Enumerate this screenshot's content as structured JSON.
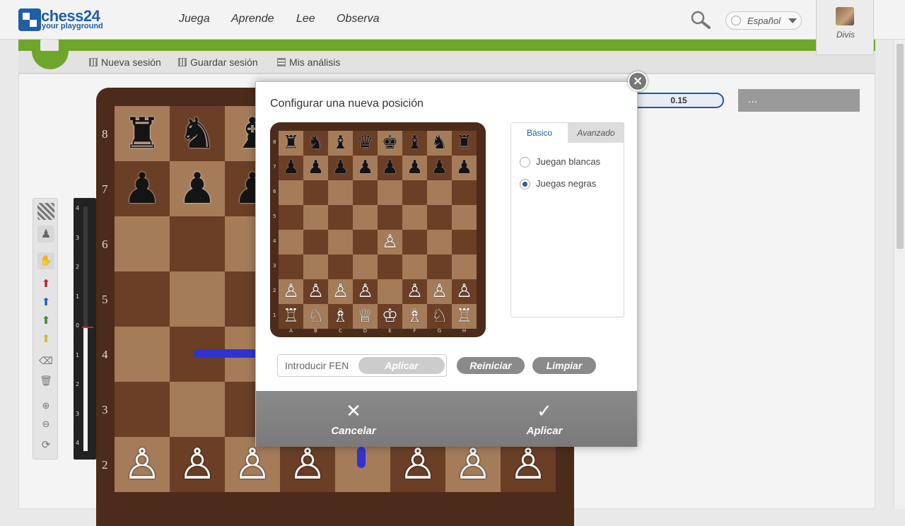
{
  "brand": {
    "name": "chess24",
    "tagline": "your playground"
  },
  "nav": {
    "items": [
      "Juega",
      "Aprende",
      "Lee",
      "Observa"
    ]
  },
  "language": {
    "selected": "Español"
  },
  "user": {
    "name": "Divis"
  },
  "subtoolbar": {
    "items": [
      "Nueva sesión",
      "Guardar sesión",
      "Mis análisis"
    ]
  },
  "evaluation": {
    "score": "0.15",
    "more": "...",
    "scale_labels": [
      "4",
      "3",
      "2",
      "1",
      "0",
      "1",
      "2",
      "3",
      "4"
    ]
  },
  "big_board": {
    "ranks": [
      "8",
      "7",
      "6",
      "5",
      "4",
      "3",
      "2"
    ],
    "visible_pieces": [
      {
        "square": "a8",
        "piece": "♜"
      },
      {
        "square": "b8",
        "piece": "♞"
      },
      {
        "square": "c8",
        "piece": "♝"
      },
      {
        "square": "a7",
        "piece": "♟"
      },
      {
        "square": "b7",
        "piece": "♟"
      },
      {
        "square": "c7",
        "piece": "♟"
      },
      {
        "square": "a2",
        "piece": "♙"
      },
      {
        "square": "b2",
        "piece": "♙"
      },
      {
        "square": "c2",
        "piece": "♙"
      },
      {
        "square": "d2",
        "piece": "♙"
      },
      {
        "square": "f2",
        "piece": "♙"
      },
      {
        "square": "g2",
        "piece": "♙"
      },
      {
        "square": "h2",
        "piece": "♙"
      }
    ]
  },
  "dialog": {
    "title": "Configurar una nueva posición",
    "close_label": "×",
    "mini_board": {
      "ranks": [
        "8",
        "7",
        "6",
        "5",
        "4",
        "3",
        "2",
        "1"
      ],
      "files": [
        "A",
        "B",
        "C",
        "D",
        "E",
        "F",
        "G",
        "H"
      ],
      "rows": [
        [
          "♜",
          "♞",
          "♝",
          "♛",
          "♚",
          "♝",
          "♞",
          "♜"
        ],
        [
          "♟",
          "♟",
          "♟",
          "♟",
          "♟",
          "♟",
          "♟",
          "♟"
        ],
        [
          "",
          "",
          "",
          "",
          "",
          "",
          "",
          ""
        ],
        [
          "",
          "",
          "",
          "",
          "",
          "",
          "",
          ""
        ],
        [
          "",
          "",
          "",
          "",
          "♙",
          "",
          "",
          ""
        ],
        [
          "",
          "",
          "",
          "",
          "",
          "",
          "",
          ""
        ],
        [
          "♙",
          "♙",
          "♙",
          "♙",
          "",
          "♙",
          "♙",
          "♙"
        ],
        [
          "♖",
          "♘",
          "♗",
          "♕",
          "♔",
          "♗",
          "♘",
          "♖"
        ]
      ]
    },
    "tabs": [
      "Básico",
      "Avanzado"
    ],
    "radio_options": [
      {
        "label": "Juegan blancas",
        "checked": false
      },
      {
        "label": "Juegas negras",
        "checked": true
      }
    ],
    "fen": {
      "placeholder": "Introducir FEN",
      "apply_label": "Aplicar"
    },
    "reset_label": "Reiniciar",
    "clear_label": "Limpiar",
    "footer": {
      "cancel_label": "Cancelar",
      "apply_label": "Aplicar"
    }
  }
}
